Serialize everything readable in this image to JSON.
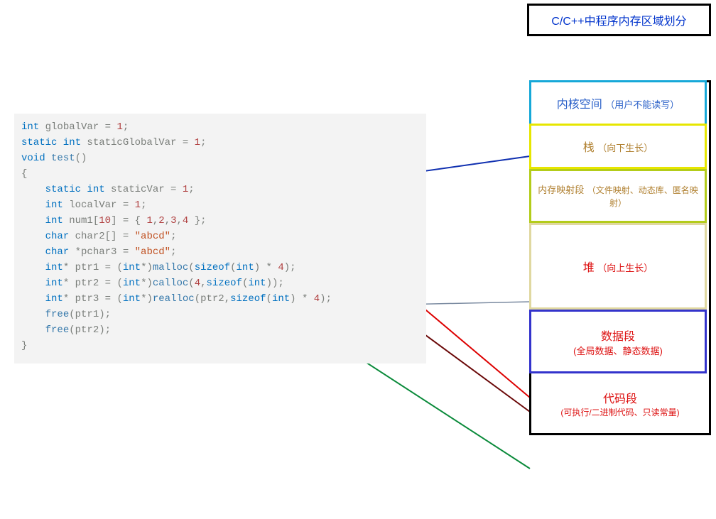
{
  "title": "C/C++中程序内存区域划分",
  "regions": {
    "kernel": {
      "main": "内核空间",
      "note": "（用户不能读写）"
    },
    "stack": {
      "main": "栈",
      "note": "（向下生长）"
    },
    "mmap": {
      "main": "内存映射段",
      "note": "（文件映射、动态库、匿名映射）"
    },
    "heap": {
      "main": "堆",
      "note": "（向上生长）"
    },
    "data": {
      "main": "数据段",
      "note": "(全局数据、静态数据)"
    },
    "code": {
      "main": "代码段",
      "note": "(可执行/二进制代码、只读常量)"
    }
  },
  "code": {
    "l1": {
      "t1": "int",
      "t2": " globalVar = ",
      "n": "1",
      "t3": ";"
    },
    "l2": {
      "t1": "static int",
      "t2": " staticGlobalVar = ",
      "n": "1",
      "t3": ";"
    },
    "l3": {
      "t1": "void",
      "t2": " ",
      "fn": "test",
      "t3": "()"
    },
    "l4": "{",
    "l5": {
      "t1": "static int",
      "t2": " staticVar = ",
      "n": "1",
      "t3": ";"
    },
    "l6": {
      "t1": "int",
      "t2": " localVar = ",
      "n": "1",
      "t3": ";"
    },
    "l7": "",
    "l8": {
      "t1": "int",
      "t2": " num1[",
      "n1": "10",
      "t3": "] = { ",
      "n2": "1",
      "c1": ",",
      "n3": "2",
      "c2": ",",
      "n4": "3",
      "c3": ",",
      "n5": "4",
      "t4": " };"
    },
    "l9": {
      "t1": "char",
      "t2": " char2[] = ",
      "s": "\"abcd\"",
      "t3": ";"
    },
    "l10": {
      "t1": "char",
      "t2": " *pchar3 = ",
      "s": "\"abcd\"",
      "t3": ";"
    },
    "l11": {
      "t1": "int",
      "t2": "* ptr1 = (",
      "cast": "int",
      "t3": "*)",
      "fn": "malloc",
      "t4": "(",
      "kw": "sizeof",
      "t5": "(",
      "ty": "int",
      "t6": ") * ",
      "n": "4",
      "t7": ");"
    },
    "l12": {
      "t1": "int",
      "t2": "* ptr2 = (",
      "cast": "int",
      "t3": "*)",
      "fn": "calloc",
      "t4": "(",
      "n1": "4",
      "t5": ",",
      "kw": "sizeof",
      "t6": "(",
      "ty": "int",
      "t7": "));"
    },
    "l13": {
      "t1": "int",
      "t2": "* ptr3 = (",
      "cast": "int",
      "t3": "*)",
      "fn": "realloc",
      "t4": "(ptr2,",
      "kw": "sizeof",
      "t5": "(",
      "ty": "int",
      "t6": ") * ",
      "n": "4",
      "t7": ");"
    },
    "l14": {
      "fn": "free",
      "t": "(ptr1);"
    },
    "l15": {
      "fn": "free",
      "t": "(ptr2);"
    },
    "l16": "}"
  },
  "_comment": "connectors visually link code fragments to memory regions: globals/static → data segment; local vars block → stack; string literals → code segment (read-only consts); malloc/calloc/realloc results → heap"
}
